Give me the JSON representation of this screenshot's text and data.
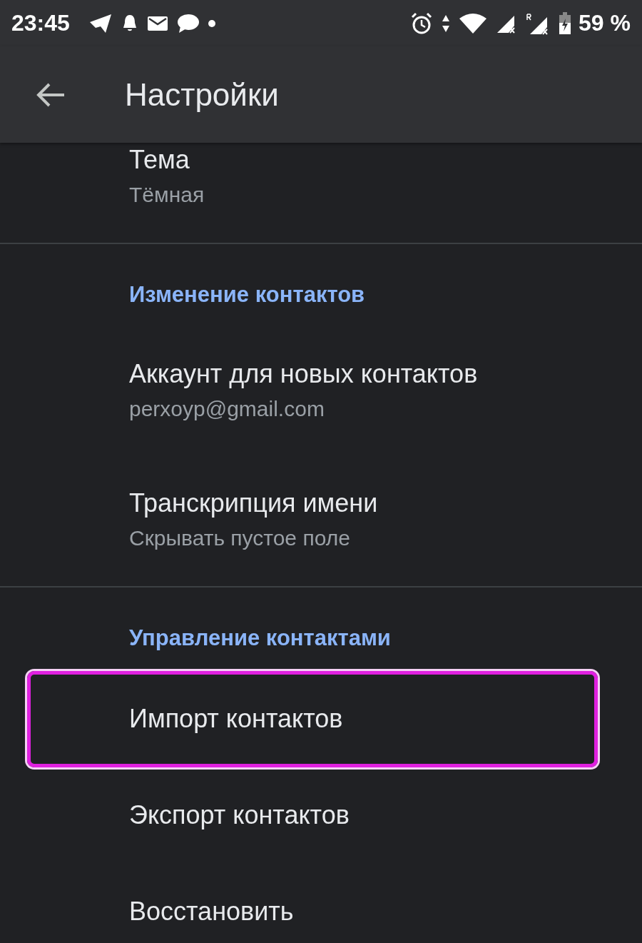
{
  "status_bar": {
    "time": "23:45",
    "battery": "59 %"
  },
  "app_bar": {
    "title": "Настройки"
  },
  "groups": [
    {
      "items": [
        {
          "title": "Тема",
          "subtitle": "Тёмная",
          "highlighted": false
        }
      ]
    },
    {
      "header": "Изменение контактов",
      "items": [
        {
          "title": "Аккаунт для новых контактов",
          "subtitle": "perxoyp@gmail.com",
          "highlighted": false
        },
        {
          "title": "Транскрипция имени",
          "subtitle": "Скрывать пустое поле",
          "highlighted": false
        }
      ]
    },
    {
      "header": "Управление контактами",
      "items": [
        {
          "title": "Импорт контактов",
          "highlighted": true
        },
        {
          "title": "Экспорт контактов",
          "highlighted": false
        },
        {
          "title": "Восстановить",
          "highlighted": false
        }
      ]
    }
  ]
}
